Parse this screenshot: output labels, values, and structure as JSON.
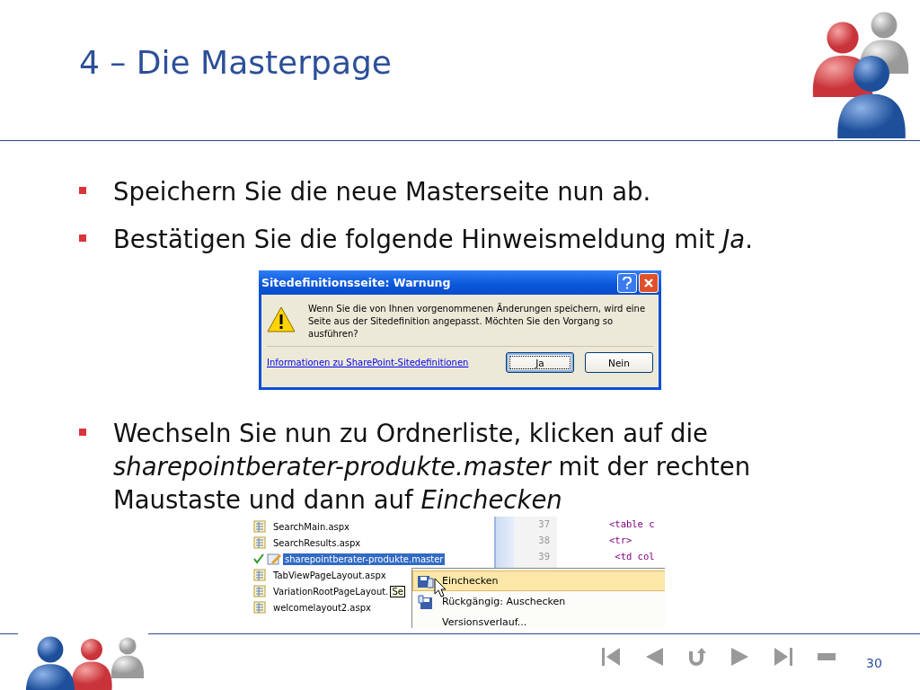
{
  "slide": {
    "title": "4 – Die Masterpage",
    "page_number": "30"
  },
  "bullets": [
    {
      "text": "Speichern Sie die neue Masterseite nun ab."
    },
    {
      "text": "Bestätigen Sie die folgende Hinweismeldung mit *Ja*."
    },
    {
      "text": "Wechseln Sie nun zu Ordnerliste, klicken auf die *sharepointberater-produkte.master* mit der rechten Maustaste und dann auf *Einchecken*"
    }
  ],
  "dialog": {
    "title": "Sitedefinitionsseite: Warnung",
    "message": "Wenn Sie die von Ihnen vorgenommenen Änderungen speichern, wird eine Seite aus der Sitedefinition angepasst. Möchten Sie den Vorgang so ausführen?",
    "link": "Informationen zu SharePoint-Sitedefinitionen",
    "buttons": [
      {
        "label": "Ja",
        "focused": true
      },
      {
        "label": "Nein",
        "focused": false
      }
    ]
  },
  "explorer": {
    "files": [
      {
        "name": "SearchMain.aspx",
        "kind": "page",
        "selected": false,
        "checked": false
      },
      {
        "name": "SearchResults.aspx",
        "kind": "page",
        "selected": false,
        "checked": false
      },
      {
        "name": "sharepointberater-produkte.master",
        "kind": "master",
        "selected": true,
        "checked": true
      },
      {
        "name": "TabViewPageLayout.aspx",
        "kind": "page",
        "selected": false,
        "checked": false
      },
      {
        "name": "VariationRootPageLayout.",
        "kind": "page",
        "selected": false,
        "checked": false,
        "tooltip": "Se"
      },
      {
        "name": "welcomelayout2.aspx",
        "kind": "page",
        "selected": false,
        "checked": false
      }
    ],
    "code": [
      {
        "line": "37",
        "code": "<table c"
      },
      {
        "line": "38",
        "code": "<tr>"
      },
      {
        "line": "39",
        "code": " <td col"
      }
    ],
    "menu": [
      {
        "label": "Einchecken",
        "selected": true
      },
      {
        "label": "Rückgängig: Auschecken",
        "selected": false
      },
      {
        "label": "Versionsverlauf...",
        "selected": false
      }
    ]
  }
}
